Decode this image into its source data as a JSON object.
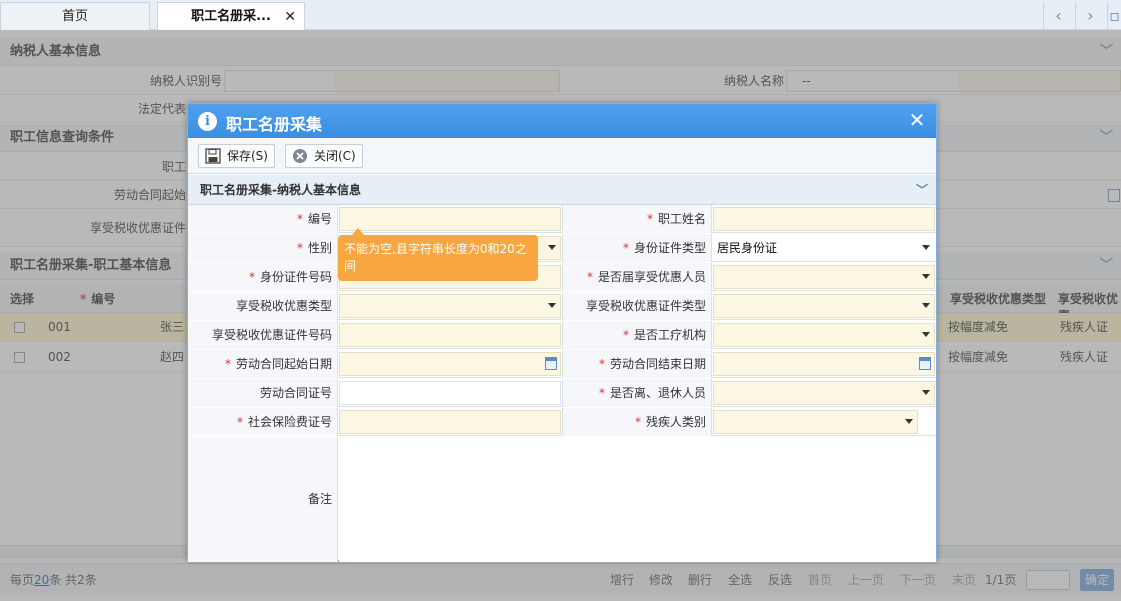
{
  "tabs": {
    "home": "首页",
    "active": "职工名册采..."
  },
  "bg": {
    "section1": "纳税人基本信息",
    "taxpayer_id_label": "纳税人识别号",
    "taxpayer_name_label": "纳税人名称",
    "taxpayer_name_value": "--",
    "legal_rep_label": "法定代表人（负",
    "section2": "职工信息查询条件",
    "query_label1": "职工",
    "query_label2": "劳动合同起始",
    "query_label3": "享受税收优惠证件",
    "section3": "职工名册采集-职工基本信息",
    "grid": {
      "select_header": "选择",
      "id_header": "编号",
      "right_headers": [
        "享受税收优惠类型",
        "享受税收优惠"
      ],
      "rows": [
        {
          "id": "001",
          "name": "张三",
          "type": "按幅度减免",
          "cert": "残疾人证"
        },
        {
          "id": "002",
          "name": "赵四",
          "type": "按幅度减免",
          "cert": "残疾人证"
        }
      ]
    },
    "footer": {
      "per_page_prefix": "每页",
      "per_page": "20",
      "per_page_suffix": "条 共2条",
      "actions": [
        "增行",
        "修改",
        "删行",
        "全选",
        "反选",
        "首页",
        "上一页",
        "下一页",
        "末页"
      ],
      "page_info": "1/1页",
      "confirm": "确定"
    }
  },
  "dialog": {
    "title": "职工名册采集",
    "save": "保存(S)",
    "close": "关闭(C)",
    "section": "职工名册采集-纳税人基本信息",
    "fields": {
      "code": "编号",
      "name": "职工姓名",
      "gender": "性别",
      "id_type": "身份证件类型",
      "id_type_value": "居民身份证",
      "id_no": "身份证件号码",
      "fresh_grad": "是否届享受优惠人员",
      "pref_type": "享受税收优惠类型",
      "pref_cert_type": "享受税收优惠证件类型",
      "pref_cert_no": "享受税收优惠证件号码",
      "injury_org": "是否工疗机构",
      "contract_start": "劳动合同起始日期",
      "contract_end": "劳动合同结束日期",
      "contract_no": "劳动合同证号",
      "retired": "是否离、退休人员",
      "social_no": "社会保险费证号",
      "disability": "残疾人类别",
      "remark": "备注"
    },
    "tooltip": "不能为空,且字符串长度为0和20之间"
  },
  "colors": {
    "accent": "#3b8ee0",
    "required": "#e0322b",
    "tooltip": "#f8a740"
  }
}
